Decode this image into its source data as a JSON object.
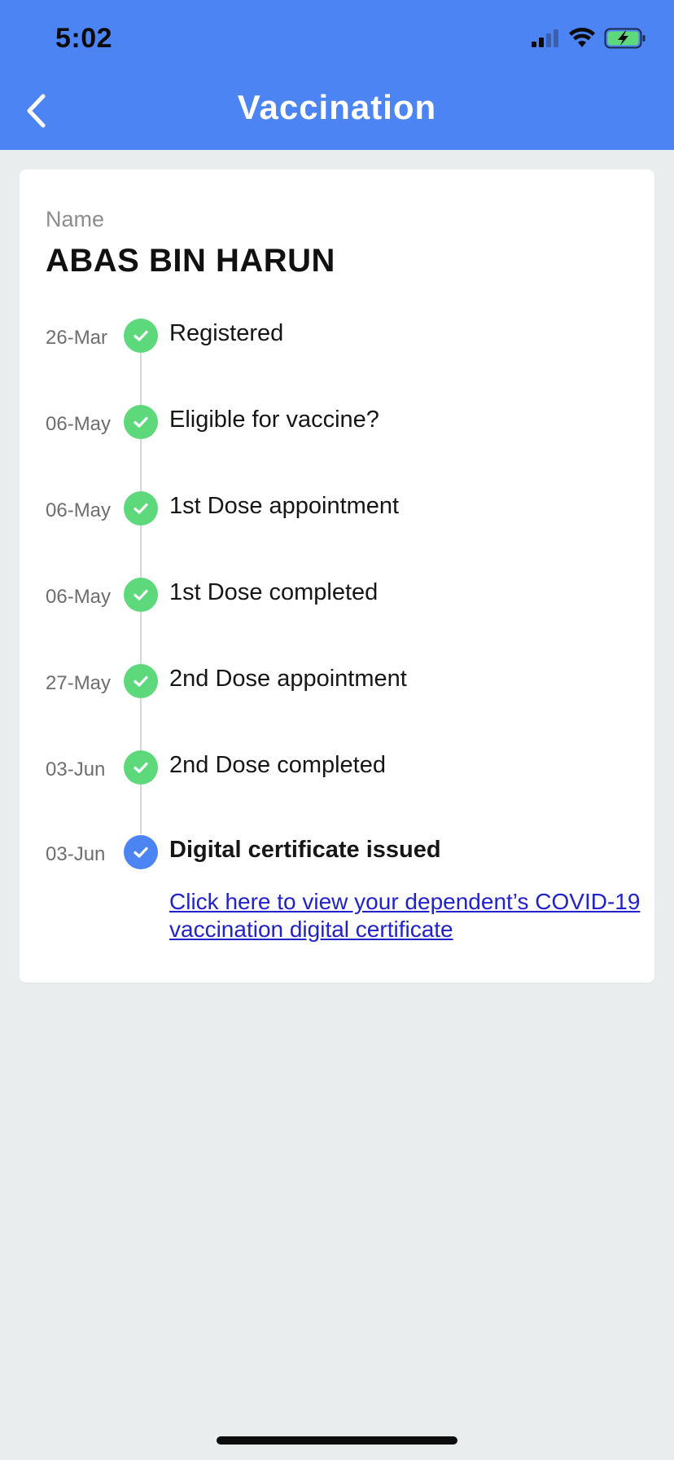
{
  "status_bar": {
    "time": "5:02",
    "icons": [
      "signal-icon",
      "wifi-icon",
      "battery-charging-icon"
    ]
  },
  "header": {
    "title": "Vaccination",
    "back_icon": "chevron-left-icon"
  },
  "profile": {
    "name_label": "Name",
    "name_value": "ABAS BIN HARUN"
  },
  "timeline": [
    {
      "date": "26-Mar",
      "label": "Registered",
      "status": "done"
    },
    {
      "date": "06-May",
      "label": "Eligible for vaccine?",
      "status": "done"
    },
    {
      "date": "06-May",
      "label": "1st Dose appointment",
      "status": "done"
    },
    {
      "date": "06-May",
      "label": "1st Dose completed",
      "status": "done"
    },
    {
      "date": "27-May",
      "label": "2nd Dose appointment",
      "status": "done"
    },
    {
      "date": "03-Jun",
      "label": "2nd Dose completed",
      "status": "done"
    },
    {
      "date": "03-Jun",
      "label": "Digital certificate issued",
      "status": "current"
    }
  ],
  "certificate_link": "Click here to view your dependent’s COVID-19 vaccination digital certificate",
  "colors": {
    "header_bg": "#4d84f4",
    "done_check": "#5dd97b",
    "current_check": "#4d84f4",
    "link": "#2222cc",
    "page_bg": "#e9edee"
  }
}
